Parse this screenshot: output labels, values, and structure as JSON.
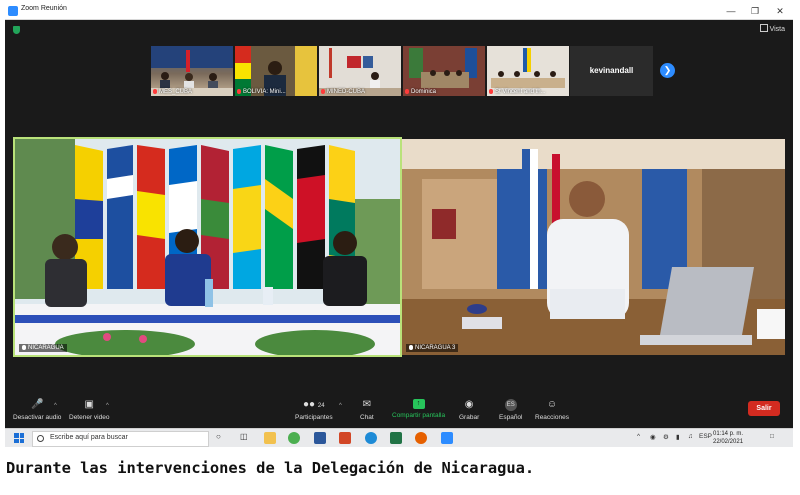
{
  "window": {
    "title": "Zoom Reunión",
    "view_label": "Vista"
  },
  "thumbnails": [
    {
      "label": "MES_CUBA"
    },
    {
      "label": "BOLIVIA: Mini..."
    },
    {
      "label": "MINED-CUBA"
    },
    {
      "label": "Dominica"
    },
    {
      "label": "St Vincent and th..."
    }
  ],
  "named_tile": "kevinandall",
  "videos": [
    {
      "label": "NICARAGUA"
    },
    {
      "label": "NICARAGUA 3"
    }
  ],
  "toolbar": {
    "audio": "Desactivar audio",
    "video": "Detener video",
    "participants": "Participantes",
    "participants_count": "24",
    "chat": "Chat",
    "share": "Compartir pantalla",
    "record": "Grabar",
    "language": "Español",
    "language_badge": "ES",
    "reactions": "Reacciones",
    "leave": "Salir"
  },
  "taskbar": {
    "search_placeholder": "Escribe aquí para buscar",
    "lang": "ESP",
    "time": "01:14 p. m.",
    "date": "22/02/2021"
  },
  "caption": "Durante las intervenciones de la Delegación de Nicaragua."
}
